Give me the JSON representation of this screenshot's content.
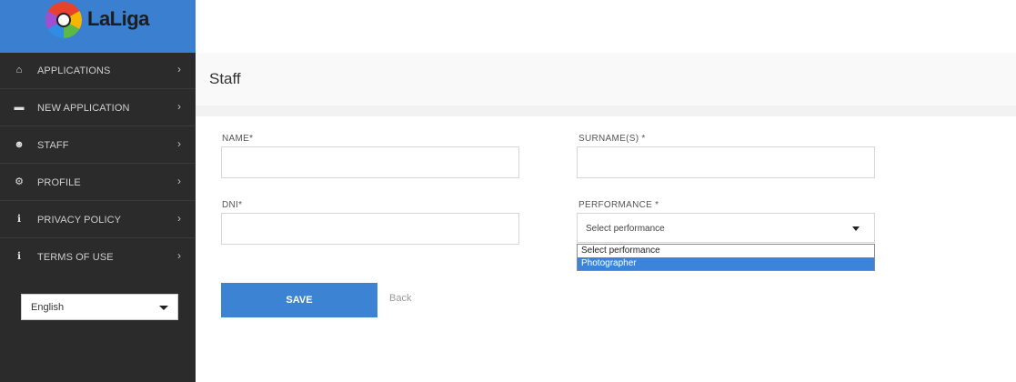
{
  "brand": {
    "logo_text": "LaLiga"
  },
  "sidebar": {
    "items": [
      {
        "label": "APPLICATIONS",
        "icon": "home-icon",
        "glyph": "⌂"
      },
      {
        "label": "NEW APPLICATION",
        "icon": "briefcase-icon",
        "glyph": "▬"
      },
      {
        "label": "STAFF",
        "icon": "add-user-icon",
        "glyph": "☻"
      },
      {
        "label": "PROFILE",
        "icon": "gears-icon",
        "glyph": "⚙"
      },
      {
        "label": "PRIVACY POLICY",
        "icon": "info-icon",
        "glyph": "ℹ"
      },
      {
        "label": "TERMS OF USE",
        "icon": "info-icon",
        "glyph": "ℹ"
      }
    ],
    "chevron": "›",
    "language": {
      "value": "English"
    }
  },
  "main": {
    "title": "Staff",
    "form": {
      "name_label": "NAME*",
      "name_value": "",
      "surname_label": "SURNAME(S) *",
      "surname_value": "",
      "dni_label": "DNI*",
      "dni_value": "",
      "performance_label": "PERFORMANCE *",
      "performance_value": "Select performance",
      "performance_options": [
        "Select performance",
        "Photographer"
      ],
      "highlighted_option": "Photographer",
      "save_label": "SAVE",
      "back_label": "Back"
    }
  },
  "colors": {
    "brand_blue": "#3a7fd0",
    "sidebar_bg": "#2b2b2b",
    "button_blue": "#3d83d4",
    "option_highlight": "#3c84d9"
  }
}
